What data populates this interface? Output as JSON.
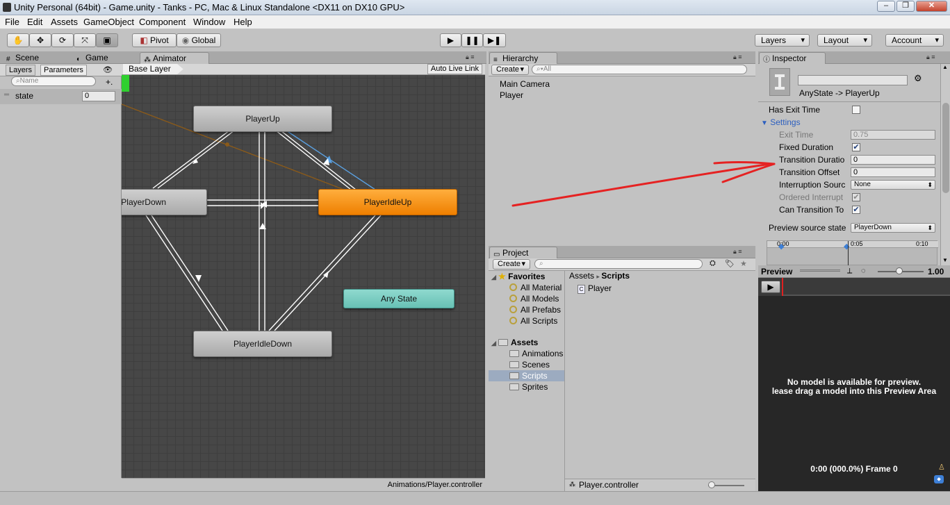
{
  "window": {
    "title": "Unity Personal (64bit) - Game.unity - Tanks - PC, Mac & Linux Standalone <DX11 on DX10 GPU>"
  },
  "menu": [
    "File",
    "Edit",
    "Assets",
    "GameObject",
    "Component",
    "Window",
    "Help"
  ],
  "toolbar": {
    "pivot": "Pivot",
    "global": "Global",
    "layers": "Layers",
    "layout": "Layout",
    "account": "Account"
  },
  "left_tabs": {
    "scene": "Scene",
    "game": "Game",
    "animator": "Animator"
  },
  "animator": {
    "subtabs": {
      "layers": "Layers",
      "parameters": "Parameters"
    },
    "search_placeholder": "Name",
    "param": {
      "name": "state",
      "value": "0"
    },
    "base_layer": "Base Layer",
    "auto_live_link": "Auto Live Link",
    "footer": "Animations/Player.controller",
    "states": {
      "up": "PlayerUp",
      "down": "PlayerDown",
      "idle_up": "PlayerIdleUp",
      "any": "Any State",
      "idle_down": "PlayerIdleDown"
    }
  },
  "hierarchy": {
    "tab": "Hierarchy",
    "create": "Create",
    "search": "All",
    "items": [
      "Main Camera",
      "Player"
    ]
  },
  "project": {
    "tab": "Project",
    "create": "Create",
    "favorites_label": "Favorites",
    "favorites": [
      "All Material",
      "All Models",
      "All Prefabs",
      "All Scripts"
    ],
    "assets_label": "Assets",
    "asset_folders": [
      "Animations",
      "Scenes",
      "Scripts",
      "Sprites"
    ],
    "breadcrumb": [
      "Assets",
      "Scripts"
    ],
    "files": [
      "Player"
    ],
    "selected_file": "Player.controller"
  },
  "inspector": {
    "tab": "Inspector",
    "transition_title": "AnyState -> PlayerUp",
    "has_exit_time": "Has Exit Time",
    "settings": "Settings",
    "exit_time": {
      "label": "Exit Time",
      "value": "0.75"
    },
    "fixed_duration": "Fixed Duration",
    "transition_duration": {
      "label": "Transition Duratio",
      "value": "0"
    },
    "transition_offset": {
      "label": "Transition Offset",
      "value": "0"
    },
    "interruption_source": {
      "label": "Interruption Sourc",
      "value": "None"
    },
    "ordered_interrupt": "Ordered Interrupt",
    "can_transition_to": "Can Transition To",
    "preview_source": {
      "label": "Preview source state",
      "value": "PlayerDown"
    },
    "timeline_ticks": [
      "0:00",
      "0:05",
      "0:10"
    ]
  },
  "preview": {
    "label": "Preview",
    "speed": "1.00",
    "msg1": "No model is available for preview.",
    "msg2": "lease drag a model into this Preview Area",
    "status": "0:00 (000.0%) Frame 0"
  },
  "colors": {
    "state_orange": "#f08a10",
    "any_state_teal": "#7ccdc2",
    "annotation_arrow": "#e02020"
  }
}
